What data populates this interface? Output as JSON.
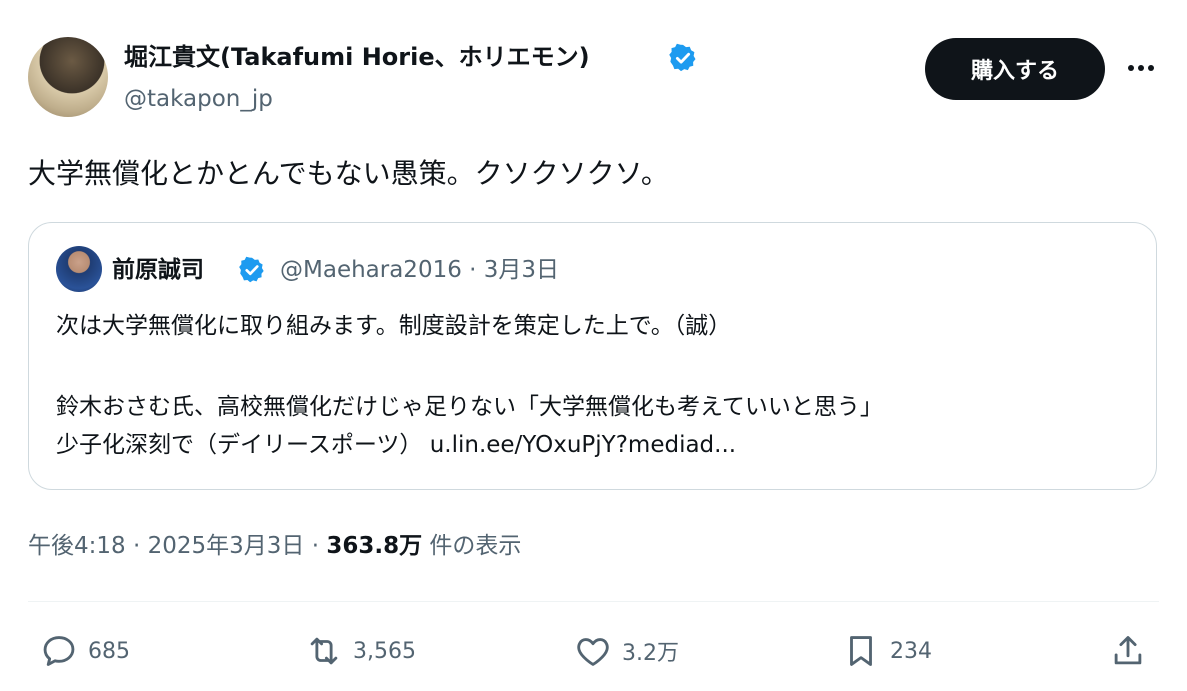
{
  "author": {
    "display_name": "堀江貴文(Takafumi Horie、ホリエモン)",
    "handle": "@takapon_jp",
    "verified": true
  },
  "header": {
    "buy_button_label": "購入する",
    "more_icon": "more-icon"
  },
  "tweet": {
    "text": "大学無償化とかとんでもない愚策。クソクソクソ。"
  },
  "quote": {
    "name": "前原誠司",
    "handle": "@Maehara2016",
    "separator": "·",
    "date": "3月3日",
    "line1": "次は大学無償化に取り組みます。制度設計を策定した上で。（誠）",
    "line2": "鈴木おさむ氏、高校無償化だけじゃ足りない「大学無償化も考えていいと思う」",
    "line3_text": "少子化深刻で（デイリースポーツ）",
    "line3_link": "u.lin.ee/YOxuPjY?mediad..."
  },
  "meta": {
    "time": "午後4:18",
    "sep1": "·",
    "date": "2025年3月3日",
    "sep2": "·",
    "views_count": "363.8万",
    "views_label": "件の表示"
  },
  "actions": {
    "reply_count": "685",
    "retweet_count": "3,565",
    "like_count": "3.2万",
    "bookmark_count": "234"
  },
  "colors": {
    "text": "#0f1419",
    "secondary": "#536471",
    "verified": "#1d9bf0",
    "border": "#cfd9de"
  }
}
